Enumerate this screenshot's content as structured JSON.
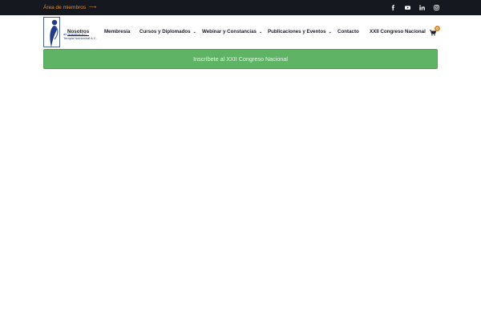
{
  "topbar": {
    "members_link": "Área de miembros",
    "members_arrow": "⟶",
    "social": [
      "facebook-icon",
      "youtube-icon",
      "linkedin-icon",
      "instagram-icon"
    ]
  },
  "logo": {
    "line1": "de Nosotros A.C.",
    "line2": "Terapia Nutricional A.C."
  },
  "nav": {
    "items": [
      {
        "label": "Nosotros",
        "has_dropdown": false
      },
      {
        "label": "Membresía",
        "has_dropdown": false
      },
      {
        "label": "Cursos y Diplomados",
        "has_dropdown": true
      },
      {
        "label": "Webinar y Constancias",
        "has_dropdown": true
      },
      {
        "label": "Publicaciones y Eventos",
        "has_dropdown": true
      },
      {
        "label": "Contacto",
        "has_dropdown": false
      },
      {
        "label": "XXII Congreso Nacional",
        "has_dropdown": false
      }
    ],
    "caret": "⌄",
    "cart_count": "0"
  },
  "cta": {
    "label": "Inscríbete al XXII Congreso Nacional"
  },
  "colors": {
    "topbar_bg": "#16181f",
    "accent_orange": "#e08a2a",
    "cta_green": "#5fb365",
    "logo_blue": "#233b86"
  }
}
